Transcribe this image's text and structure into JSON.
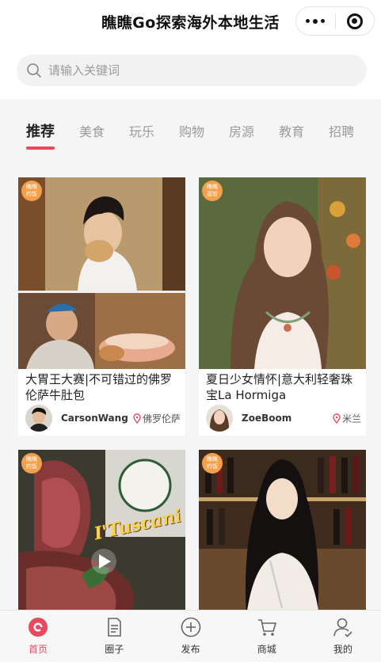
{
  "header": {
    "title": "瞧瞧Go探索海外本地生活",
    "more_icon": "more-dots-icon",
    "close_icon": "record-circle-icon"
  },
  "search": {
    "placeholder": "请输入关键词",
    "icon": "search-icon"
  },
  "tabs": [
    {
      "label": "推荐",
      "active": true
    },
    {
      "label": "美食"
    },
    {
      "label": "玩乐"
    },
    {
      "label": "购物"
    },
    {
      "label": "房源"
    },
    {
      "label": "教育"
    },
    {
      "label": "招聘"
    }
  ],
  "cards": [
    {
      "badge": "瞧瞧\n约饭",
      "title": "大胃王大赛|不可错过的佛罗伦萨牛肚包",
      "user": "CarsonWang",
      "location": "佛罗伦萨"
    },
    {
      "badge": "瞧瞧\n逛街",
      "title": "夏日少女情怀|意大利轻奢珠宝La Hormiga",
      "user": "ZoeBoom",
      "location": "米兰"
    },
    {
      "badge": "瞧瞧\n约饭",
      "overlay_text": "I'Tuscani"
    },
    {
      "badge": "瞧瞧\n约饭"
    }
  ],
  "tabbar": [
    {
      "label": "首页",
      "icon": "home-icon",
      "active": true
    },
    {
      "label": "圈子",
      "icon": "document-icon"
    },
    {
      "label": "发布",
      "icon": "plus-circle-icon"
    },
    {
      "label": "商城",
      "icon": "cart-icon"
    },
    {
      "label": "我的",
      "icon": "user-icon"
    }
  ],
  "colors": {
    "accent": "#e9485f",
    "badge": "#f3a04c"
  }
}
